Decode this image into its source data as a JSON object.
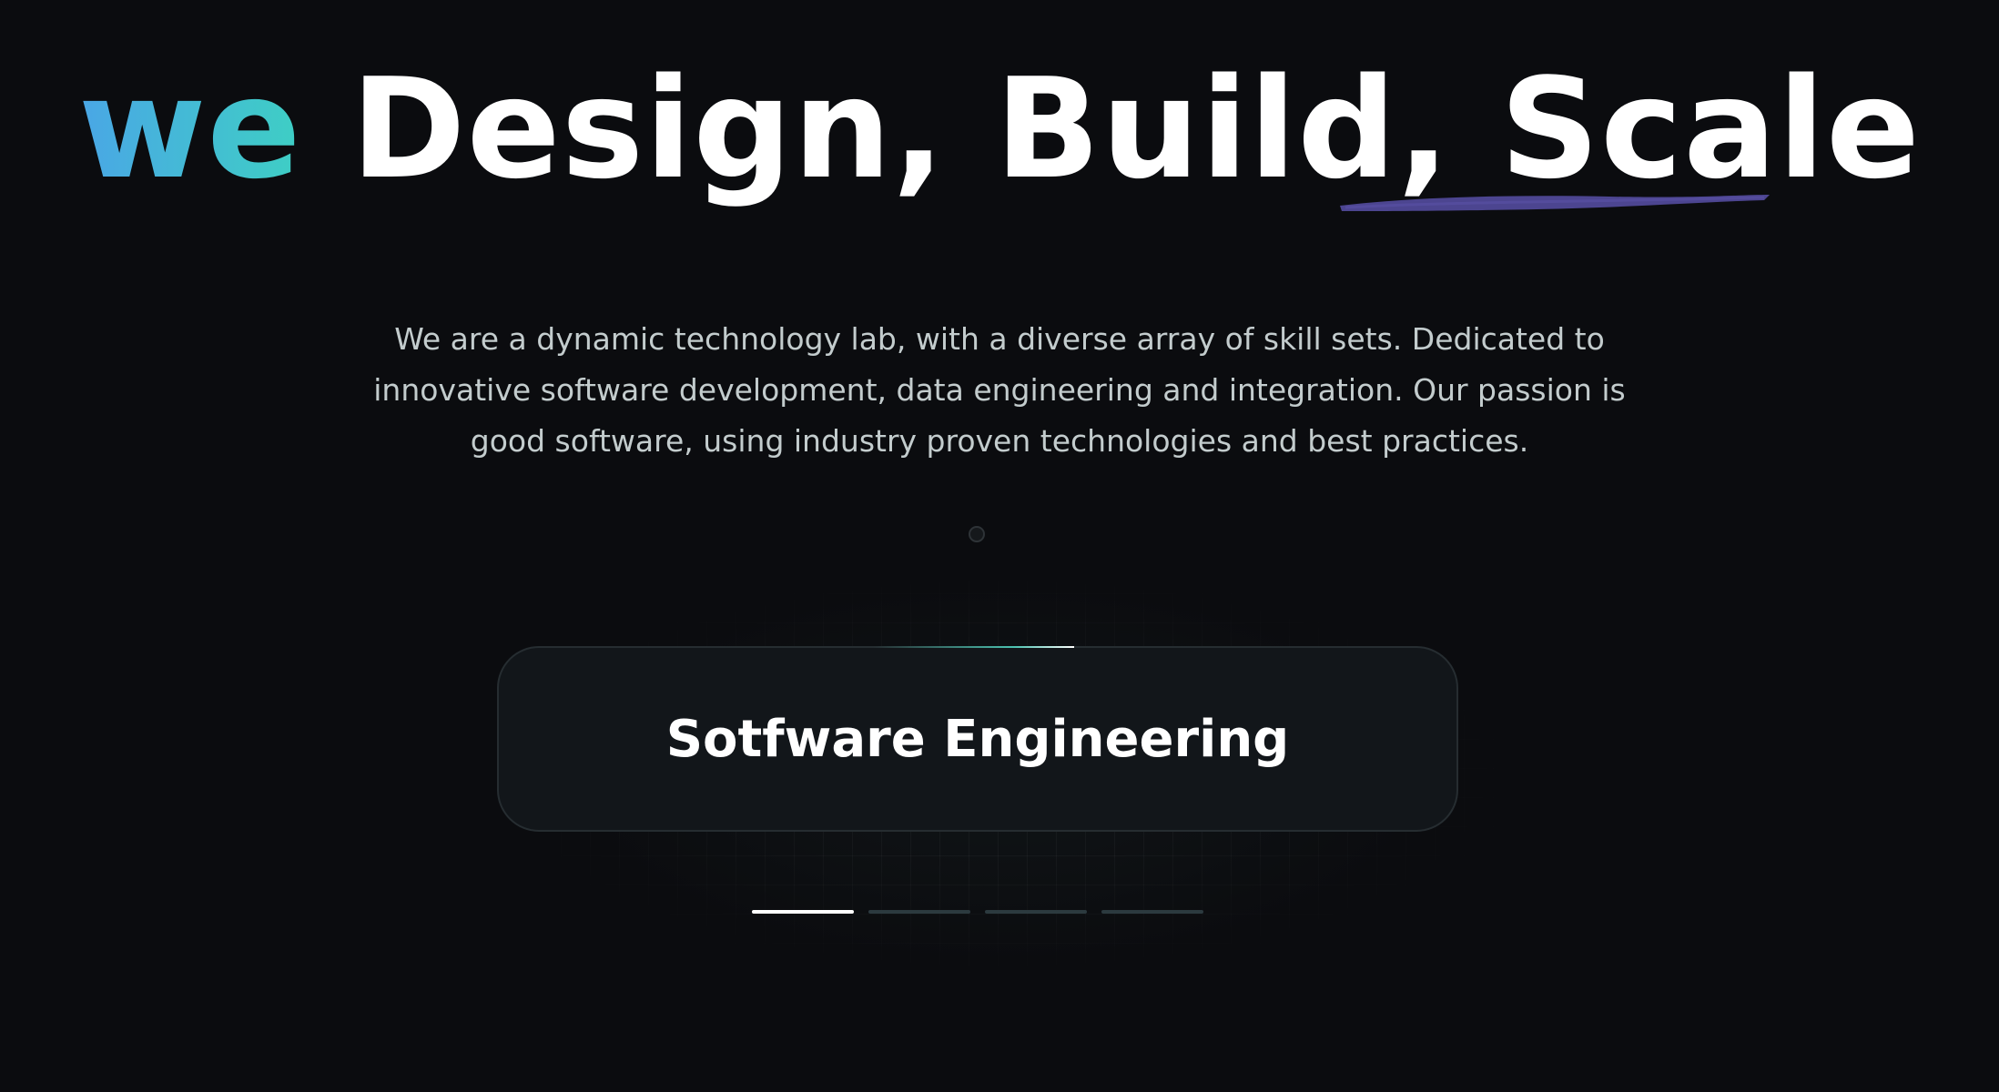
{
  "hero": {
    "title_lead": "we",
    "title_rest": "Design, Build,",
    "title_scale": "Scale",
    "gradient_colors": [
      "#4aa6e6",
      "#3ecfc4"
    ],
    "underline_color": "#4c4590"
  },
  "intro": {
    "text": "We are a dynamic technology lab, with a diverse array of skill sets. Dedicated to innovative software development, data engineering and integration. Our passion is good software, using industry proven technologies and best practices."
  },
  "carousel": {
    "current_label": "Sotfware Engineering",
    "slide_count": 4,
    "active_index": 0
  }
}
